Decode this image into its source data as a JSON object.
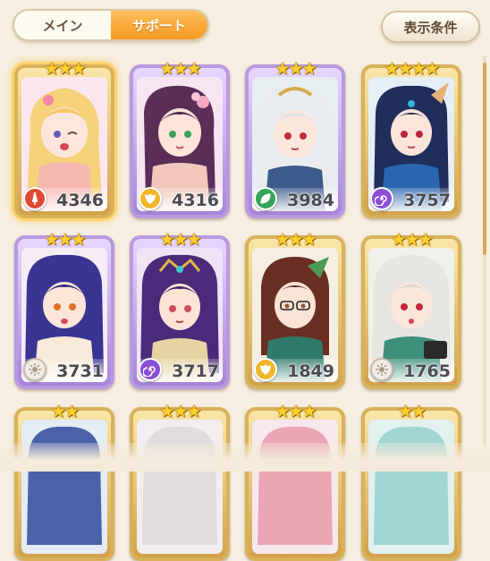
{
  "tabs": [
    {
      "label": "メイン",
      "active": false
    },
    {
      "label": "サポート",
      "active": true
    }
  ],
  "filter_button": {
    "label": "表示条件"
  },
  "cards": [
    {
      "stars": "★★★",
      "power": "4346",
      "attribute": "fire-sword-icon",
      "frame": "gold",
      "selected": true
    },
    {
      "stars": "★★★",
      "power": "4316",
      "attribute": "wing-icon",
      "frame": "purple",
      "selected": false
    },
    {
      "stars": "★★★",
      "power": "3984",
      "attribute": "leaf-icon",
      "frame": "purple",
      "selected": false
    },
    {
      "stars": "★★★★",
      "power": "3757",
      "attribute": "swirl-icon",
      "frame": "gold",
      "selected": false
    },
    {
      "stars": "★★★",
      "power": "3731",
      "attribute": "sun-icon",
      "frame": "purple",
      "selected": false
    },
    {
      "stars": "★★★",
      "power": "3717",
      "attribute": "swirl-icon",
      "frame": "purple",
      "selected": false
    },
    {
      "stars": "★★★",
      "power": "1849",
      "attribute": "wing-icon",
      "frame": "gold",
      "selected": false
    },
    {
      "stars": "★★★",
      "power": "1765",
      "attribute": "sun-icon",
      "frame": "gold",
      "selected": false
    },
    {
      "stars": "★★",
      "power": "",
      "attribute": "",
      "frame": "gold",
      "selected": false
    },
    {
      "stars": "★★★",
      "power": "",
      "attribute": "",
      "frame": "gold",
      "selected": false
    },
    {
      "stars": "★★★",
      "power": "",
      "attribute": "",
      "frame": "gold",
      "selected": false
    },
    {
      "stars": "★★",
      "power": "",
      "attribute": "",
      "frame": "gold",
      "selected": false
    }
  ],
  "colors": {
    "accent": "#f59a23",
    "background": "#f6eee0"
  }
}
